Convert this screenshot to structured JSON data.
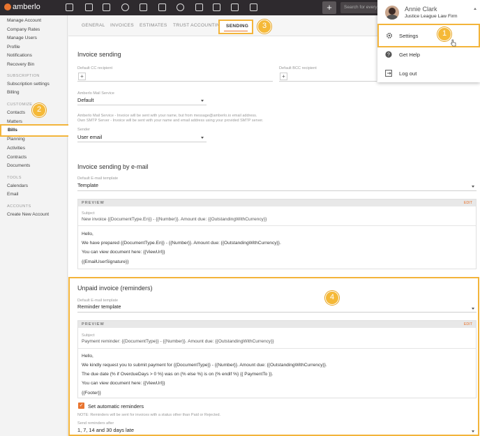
{
  "app": {
    "logo": "amberlo"
  },
  "topbar": {
    "search_placeholder": "Search for every",
    "icons": [
      "dashboard-icon",
      "contacts-icon",
      "matters-icon",
      "bills-icon",
      "bank-icon",
      "calendar-icon",
      "time-icon",
      "folder-icon",
      "documents-icon",
      "mail-icon",
      "reports-icon"
    ]
  },
  "sidebar": {
    "items": [
      {
        "label": "Manage Account"
      },
      {
        "label": "Company Rates"
      },
      {
        "label": "Manage Users"
      },
      {
        "label": "Profile"
      },
      {
        "label": "Notifications"
      },
      {
        "label": "Recovery Bin"
      }
    ],
    "sec_subscription": "SUBSCRIPTION",
    "subscription": [
      {
        "label": "Subscription settings"
      },
      {
        "label": "Billing"
      }
    ],
    "sec_customize": "CUSTOMIZE",
    "customize": [
      {
        "label": "Contacts"
      },
      {
        "label": "Matters"
      },
      {
        "label": "Bills"
      },
      {
        "label": "Planning"
      },
      {
        "label": "Activities"
      },
      {
        "label": "Contracts"
      },
      {
        "label": "Documents"
      }
    ],
    "sec_tools": "TOOLS",
    "tools": [
      {
        "label": "Calendars"
      },
      {
        "label": "Email"
      }
    ],
    "sec_accounts": "ACCOUNTS",
    "accounts": [
      {
        "label": "Create New Account"
      }
    ]
  },
  "tabs": [
    "GENERAL",
    "INVOICES",
    "ESTIMATES",
    "TRUST ACCOUNTING",
    "SENDING"
  ],
  "badges": [
    "1",
    "2",
    "3",
    "4"
  ],
  "invoice_sending": {
    "title": "Invoice sending",
    "cc_label": "Default CC recipient",
    "bcc_label": "Default BCC recipient",
    "mail_service_label": "Amberlo Mail Service",
    "mail_service_value": "Default",
    "note_1": "Amberlo Mail Service - Invoice will be sent with your name, but from message@amberlo.io email address.",
    "note_2": "Own SMTP Server - Invoice will be sent with your name and email address using your provided SMTP server.",
    "sender_label": "Sender",
    "sender_value": "User email"
  },
  "by_email": {
    "title": "Invoice sending by e-mail",
    "template_label": "Default E-mail template",
    "template_value": "Template",
    "preview_title": "PREVIEW",
    "edit": "EDIT",
    "subject_label": "Subject",
    "subject_value": "New invoice {{DocumentType.En}} - {{Number}}. Amount due: {{OutstandingWithCurrency}}",
    "body": [
      "Hello,",
      "We have prepared {{DocumentType.En}} - {{Number}}. Amount due: {{OutstandingWithCurrency}}.",
      "You can view document here: {{ViewUrl}}",
      "{{EmailUserSignature}}"
    ]
  },
  "reminders": {
    "title": "Unpaid invoice (reminders)",
    "template_label": "Default E-mail template",
    "template_value": "Reminder template",
    "preview_title": "PREVIEW",
    "edit": "EDIT",
    "subject_label": "Subject",
    "subject_value": "Payment reminder: {{DocumentType}} - {{Number}}. Amount due: {{OutstandingWithCurrency}}",
    "body": [
      "Hello,",
      "We kindly request you to submit payment for {{DocumentType}} - {{Number}}. Amount due: {{OutstandingWithCurrency}}.",
      "The due date {% if OverdueDays > 0 %} was on {% else %} is on {% endif %} {{ PaymentTo }}.",
      "You can view document here: {{ViewUrl}}",
      "{{Footer}}"
    ],
    "auto_label": "Set automatic reminders",
    "auto_checked": true,
    "auto_note": "NOTE: Reminders will be sent for invoices with a status other than Paid or Rejected.",
    "after_label": "Send reminders after",
    "after_value": "1, 7, 14 and 30 days late"
  },
  "dropdown": {
    "name": "Annie Clark",
    "firm": "Justice League Law Firm",
    "settings": "Settings",
    "help": "Get Help",
    "logout": "Log out"
  }
}
